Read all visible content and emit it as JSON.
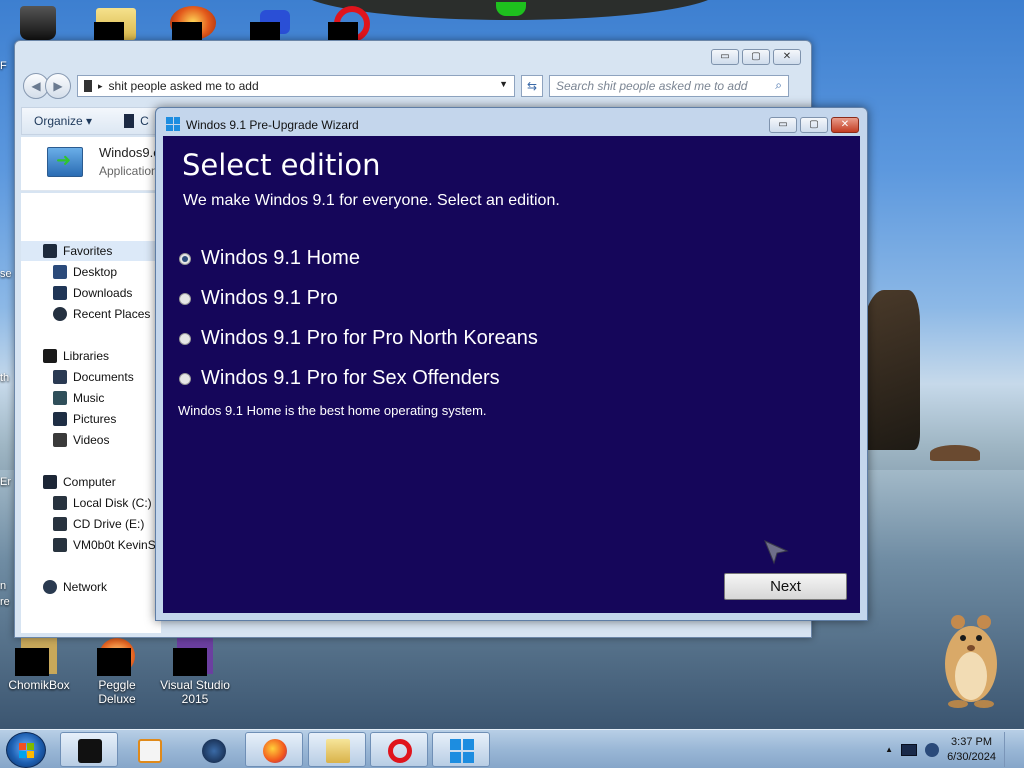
{
  "desktop": {
    "icons": [
      {
        "label": "ChomikBox"
      },
      {
        "label": "Peggle Deluxe"
      },
      {
        "label": "Visual Studio 2015"
      }
    ],
    "edge_fragments": [
      "F",
      "se",
      "th",
      "Er",
      "n",
      "re"
    ]
  },
  "explorer": {
    "address": "shit people asked me to add",
    "search_placeholder": "Search shit people asked me to add",
    "toolbar": {
      "organize": "Organize ▾",
      "more": "C"
    },
    "file": {
      "name": "Windos9.e",
      "type": "Application"
    },
    "nav": {
      "favorites": "Favorites",
      "desktop": "Desktop",
      "downloads": "Downloads",
      "recent": "Recent Places",
      "libraries": "Libraries",
      "documents": "Documents",
      "music": "Music",
      "pictures": "Pictures",
      "videos": "Videos",
      "computer": "Computer",
      "local_disk": "Local Disk (C:)",
      "cd_drive": "CD Drive (E:)",
      "vm": "VM0b0t KevinSi",
      "network": "Network"
    }
  },
  "wizard": {
    "title": "Windos 9.1 Pre-Upgrade Wizard",
    "heading": "Select edition",
    "subheading": "We make Windos 9.1 for everyone. Select an edition.",
    "options": [
      {
        "label": "Windos 9.1 Home",
        "selected": true
      },
      {
        "label": "Windos 9.1 Pro",
        "selected": false
      },
      {
        "label": "Windos 9.1 Pro for Pro North Koreans",
        "selected": false
      },
      {
        "label": "Windos 9.1 Pro for Sex Offenders",
        "selected": false
      }
    ],
    "description": "Windos 9.1 Home is the best home operating system.",
    "next_label": "Next",
    "content_bg": "#15065a"
  },
  "taskbar": {
    "time": "3:37 PM",
    "date": "6/30/2024",
    "tray_arrow": "▲"
  },
  "caption_glyphs": {
    "min": "▭",
    "max": "▢",
    "close": "✕"
  }
}
